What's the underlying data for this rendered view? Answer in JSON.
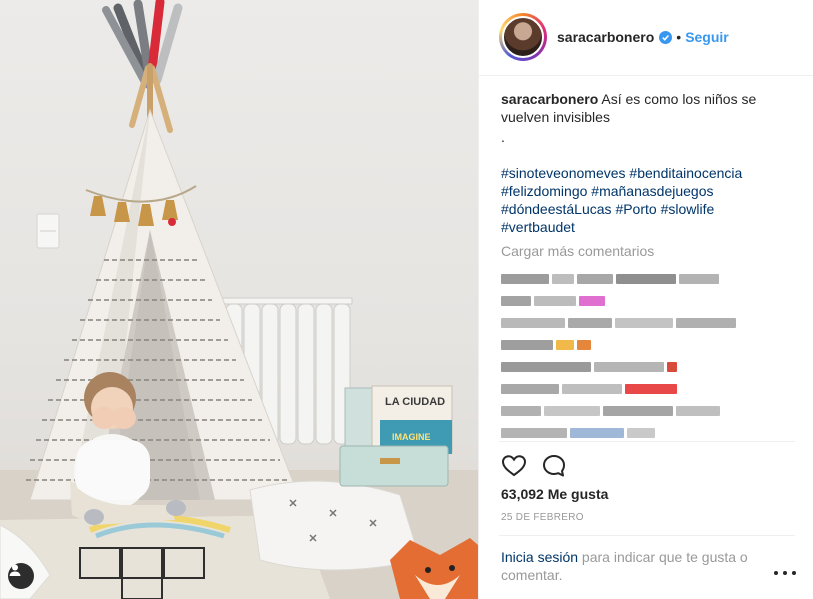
{
  "post": {
    "username": "saracarbonero",
    "follow_label": "Seguir",
    "separator": "•",
    "caption_user": "saracarbonero",
    "caption_text": "Así es como los niños se vuelven invisibles",
    "caption_dot": ".",
    "hashtags": [
      "#sinoteveonomeves",
      "#benditainocencia",
      "#felizdomingo",
      "#mañanasdejuegos",
      "#dóndeestáLucas",
      "#Porto",
      "#slowlife",
      "#vertbaudet"
    ],
    "load_more_label": "Cargar más comentarios",
    "likes_label": "63,092 Me gusta",
    "date_label": "25 DE FEBRERO",
    "login_link": "Inicia sesión",
    "login_rest": " para indicar que te gusta o comentar."
  },
  "photo": {
    "book_title": "LA CIUDAD",
    "book2_title": "IMAGINE"
  },
  "colors": {
    "link": "#003569",
    "accent": "#3897f0",
    "muted": "#999999",
    "text": "#262626"
  },
  "icons": [
    "user-tag-icon",
    "verified-badge-icon",
    "heart-icon",
    "comment-icon",
    "more-options-icon"
  ]
}
